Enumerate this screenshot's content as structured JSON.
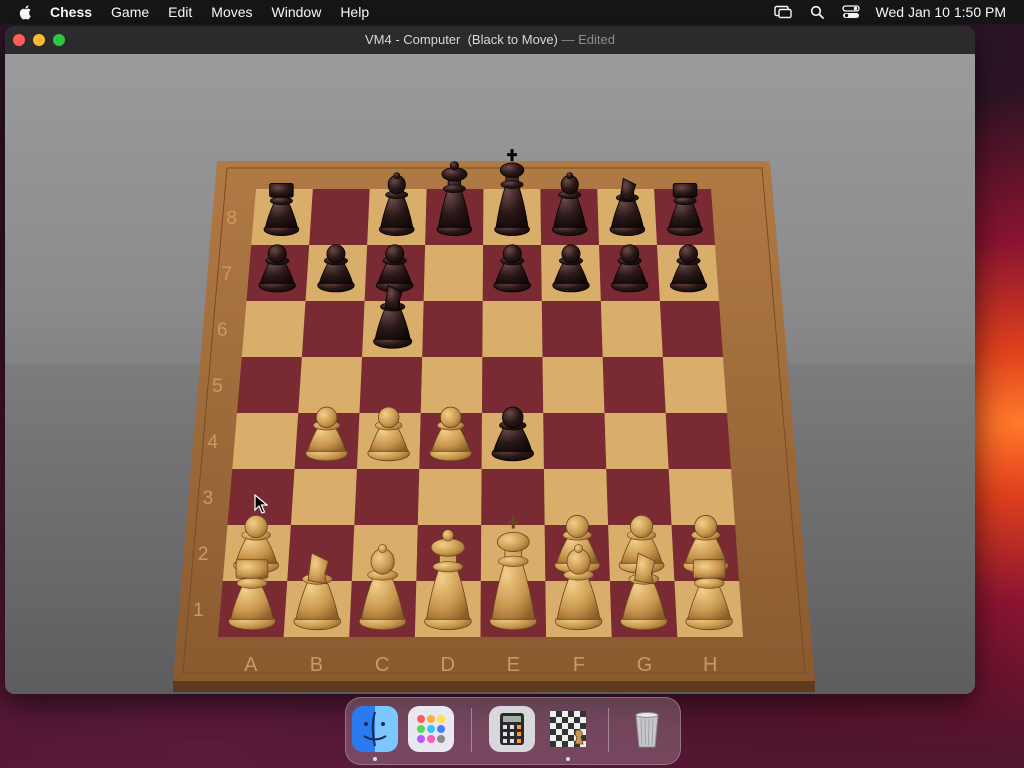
{
  "menubar": {
    "app_name": "Chess",
    "items": [
      "Game",
      "Edit",
      "Moves",
      "Window",
      "Help"
    ],
    "clock": "Wed Jan 10  1:50 PM"
  },
  "window": {
    "title_main": "VM4 - Computer  (Black to Move)",
    "title_sep": " — ",
    "title_edited": "Edited"
  },
  "board": {
    "files": [
      "A",
      "B",
      "C",
      "D",
      "E",
      "F",
      "G",
      "H"
    ],
    "ranks": [
      "8",
      "7",
      "6",
      "5",
      "4",
      "3",
      "2",
      "1"
    ],
    "light_square": "#d9ae6a",
    "dark_square": "#7a2a33",
    "frame_color": "#9a6a3a",
    "pieces": [
      {
        "color": "black",
        "type": "rook",
        "square": "a8"
      },
      {
        "color": "black",
        "type": "bishop",
        "square": "c8"
      },
      {
        "color": "black",
        "type": "queen",
        "square": "d8"
      },
      {
        "color": "black",
        "type": "king",
        "square": "e8"
      },
      {
        "color": "black",
        "type": "bishop",
        "square": "f8"
      },
      {
        "color": "black",
        "type": "knight",
        "square": "g8"
      },
      {
        "color": "black",
        "type": "rook",
        "square": "h8"
      },
      {
        "color": "black",
        "type": "pawn",
        "square": "a7"
      },
      {
        "color": "black",
        "type": "pawn",
        "square": "b7"
      },
      {
        "color": "black",
        "type": "pawn",
        "square": "c7"
      },
      {
        "color": "black",
        "type": "pawn",
        "square": "e7"
      },
      {
        "color": "black",
        "type": "pawn",
        "square": "f7"
      },
      {
        "color": "black",
        "type": "pawn",
        "square": "g7"
      },
      {
        "color": "black",
        "type": "pawn",
        "square": "h7"
      },
      {
        "color": "black",
        "type": "knight",
        "square": "c6"
      },
      {
        "color": "black",
        "type": "pawn",
        "square": "e4"
      },
      {
        "color": "white",
        "type": "pawn",
        "square": "b4"
      },
      {
        "color": "white",
        "type": "pawn",
        "square": "c4"
      },
      {
        "color": "white",
        "type": "pawn",
        "square": "d4"
      },
      {
        "color": "white",
        "type": "pawn",
        "square": "a2"
      },
      {
        "color": "white",
        "type": "pawn",
        "square": "f2"
      },
      {
        "color": "white",
        "type": "pawn",
        "square": "g2"
      },
      {
        "color": "white",
        "type": "pawn",
        "square": "h2"
      },
      {
        "color": "white",
        "type": "rook",
        "square": "a1"
      },
      {
        "color": "white",
        "type": "knight",
        "square": "b1"
      },
      {
        "color": "white",
        "type": "bishop",
        "square": "c1"
      },
      {
        "color": "white",
        "type": "queen",
        "square": "d1"
      },
      {
        "color": "white",
        "type": "king",
        "square": "e1"
      },
      {
        "color": "white",
        "type": "bishop",
        "square": "f1"
      },
      {
        "color": "white",
        "type": "knight",
        "square": "g1"
      },
      {
        "color": "white",
        "type": "rook",
        "square": "h1"
      }
    ]
  },
  "dock": {
    "items": [
      {
        "icon": "finder-icon",
        "running": true
      },
      {
        "icon": "launchpad-icon",
        "running": false
      },
      {
        "icon": "calculator-icon",
        "running": false
      },
      {
        "icon": "chess-app-icon",
        "running": true
      },
      {
        "icon": "trash-icon",
        "running": false
      }
    ]
  }
}
